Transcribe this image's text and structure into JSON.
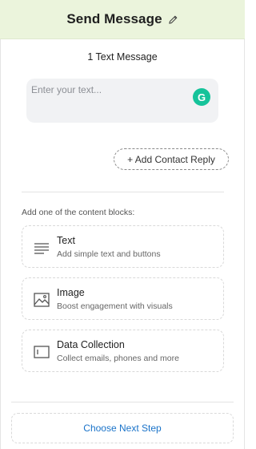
{
  "header": {
    "title": "Send Message",
    "edit_icon": "pencil-icon"
  },
  "message": {
    "subtitle": "1 Text Message",
    "input_placeholder": "Enter your text...",
    "input_value": "",
    "assistant_badge": "G"
  },
  "contact_reply": {
    "label": "+ Add Contact Reply"
  },
  "content_blocks": {
    "label": "Add one of the content blocks:",
    "items": [
      {
        "title": "Text",
        "description": "Add simple text and buttons",
        "icon": "text-lines-icon"
      },
      {
        "title": "Image",
        "description": "Boost engagement with visuals",
        "icon": "image-icon"
      },
      {
        "title": "Data Collection",
        "description": "Collect emails, phones and more",
        "icon": "input-field-icon"
      }
    ]
  },
  "footer": {
    "next_step_label": "Choose Next Step"
  },
  "colors": {
    "header_bg": "#ebf4dc",
    "link": "#1a73c9",
    "assistant": "#15c39a"
  }
}
